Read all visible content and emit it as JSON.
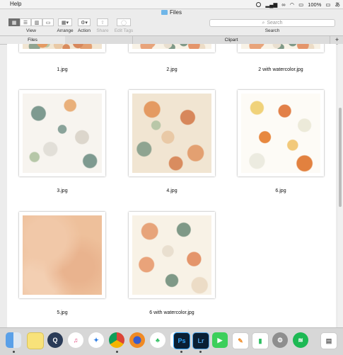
{
  "menubar": {
    "help": "Help",
    "battery": "100%"
  },
  "window": {
    "title": "Files"
  },
  "toolbar": {
    "view_label": "View",
    "arrange_label": "Arrange",
    "action_label": "Action",
    "share_label": "Share",
    "edit_tags_label": "Edit Tags",
    "search_label": "Search",
    "search_placeholder": "Search"
  },
  "tabs": [
    {
      "label": "Files",
      "active": true
    },
    {
      "label": "Clipart",
      "active": false
    }
  ],
  "files": [
    {
      "name": "1.jpg"
    },
    {
      "name": "2.jpg"
    },
    {
      "name": "2 with watercolor.jpg"
    },
    {
      "name": "3.jpg"
    },
    {
      "name": "4.jpg"
    },
    {
      "name": "6.jpg"
    },
    {
      "name": "5.jpg"
    },
    {
      "name": "6 with watercolor.jpg"
    }
  ],
  "dock": {
    "icons": [
      "finder-icon",
      "notes-icon",
      "quicktime-icon",
      "itunes-icon",
      "safari-icon",
      "chrome-icon",
      "firefox-icon",
      "evernote-icon",
      "google-drive-icon",
      "photoshop-icon",
      "lightroom-icon",
      "facetime-icon",
      "messages-icon",
      "pages-icon",
      "numbers-icon",
      "system-preferences-icon",
      "spotify-icon",
      "preview-icon"
    ],
    "photoshop_label": "Ps",
    "lightroom_label": "Lr"
  },
  "colors": {
    "accent": "#2a7be4",
    "folder": "#6fb6e8"
  }
}
